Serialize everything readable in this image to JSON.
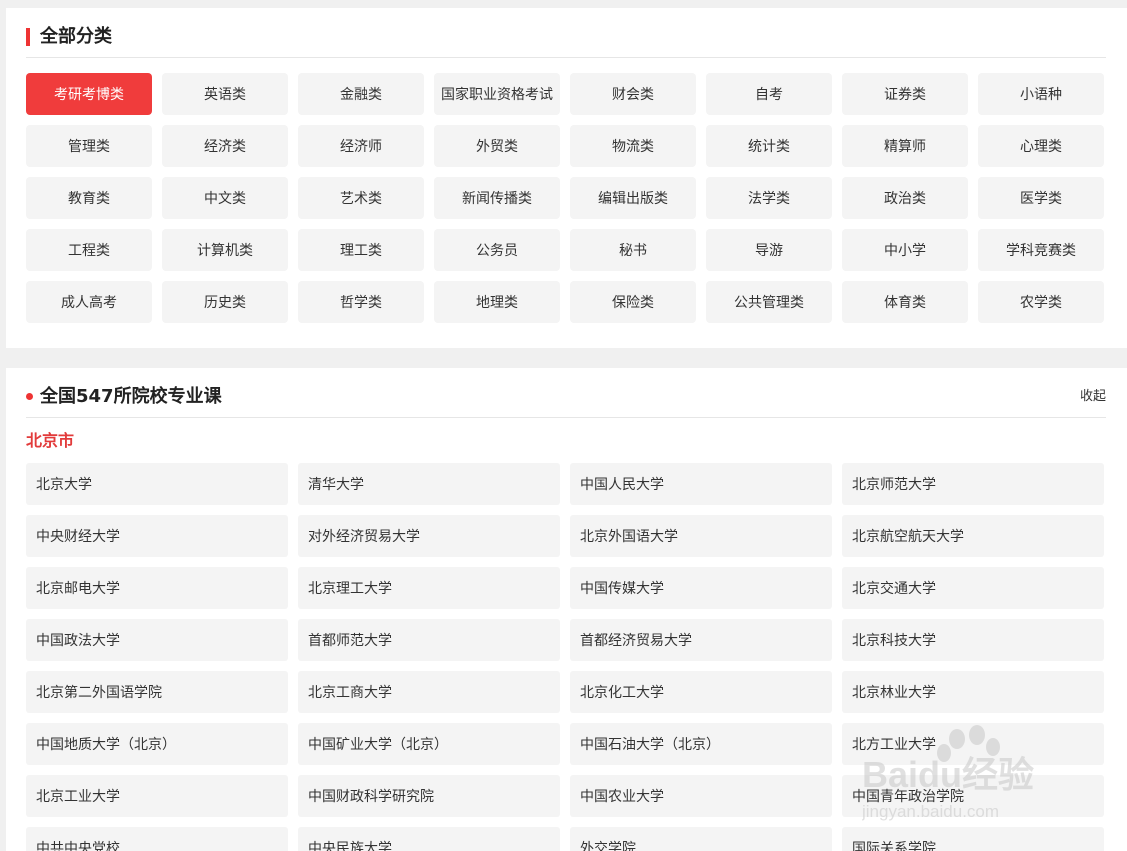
{
  "categories": {
    "title": "全部分类",
    "items": [
      "考研考博类",
      "英语类",
      "金融类",
      "国家职业资格考试",
      "财会类",
      "自考",
      "证券类",
      "小语种",
      "管理类",
      "经济类",
      "经济师",
      "外贸类",
      "物流类",
      "统计类",
      "精算师",
      "心理类",
      "教育类",
      "中文类",
      "艺术类",
      "新闻传播类",
      "编辑出版类",
      "法学类",
      "政治类",
      "医学类",
      "工程类",
      "计算机类",
      "理工类",
      "公务员",
      "秘书",
      "导游",
      "中小学",
      "学科竞赛类",
      "成人高考",
      "历史类",
      "哲学类",
      "地理类",
      "保险类",
      "公共管理类",
      "体育类",
      "农学类"
    ],
    "active_index": 0
  },
  "schools": {
    "title": "全国547所院校专业课",
    "collapse_label": "收起",
    "city": "北京市",
    "items": [
      "北京大学",
      "清华大学",
      "中国人民大学",
      "北京师范大学",
      "中央财经大学",
      "对外经济贸易大学",
      "北京外国语大学",
      "北京航空航天大学",
      "北京邮电大学",
      "北京理工大学",
      "中国传媒大学",
      "北京交通大学",
      "中国政法大学",
      "首都师范大学",
      "首都经济贸易大学",
      "北京科技大学",
      "北京第二外国语学院",
      "北京工商大学",
      "北京化工大学",
      "北京林业大学",
      "中国地质大学（北京）",
      "中国矿业大学（北京）",
      "中国石油大学（北京）",
      "北方工业大学",
      "北京工业大学",
      "中国财政科学研究院",
      "中国农业大学",
      "中国青年政治学院",
      "中共中央党校",
      "中央民族大学",
      "外交学院",
      "国际关系学院"
    ]
  },
  "watermark": {
    "brand_text": "Baidu经验",
    "url_text": "jingyan.baidu.com"
  },
  "colors": {
    "accent": "#f03c3c",
    "city": "#e23b3b",
    "button_bg": "#f4f4f4",
    "page_bg": "#f0f0f0"
  }
}
